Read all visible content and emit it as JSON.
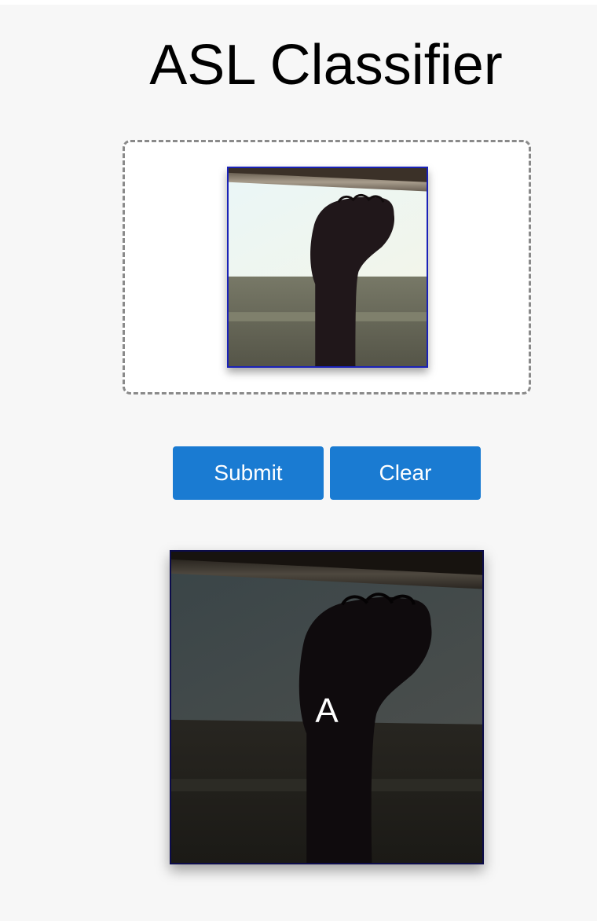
{
  "header": {
    "title": "ASL Classifier"
  },
  "upload": {
    "image_icon": "hand-fist-photo"
  },
  "actions": {
    "submit_label": "Submit",
    "clear_label": "Clear",
    "button_color": "#1a7bd2"
  },
  "result": {
    "prediction": "A"
  }
}
